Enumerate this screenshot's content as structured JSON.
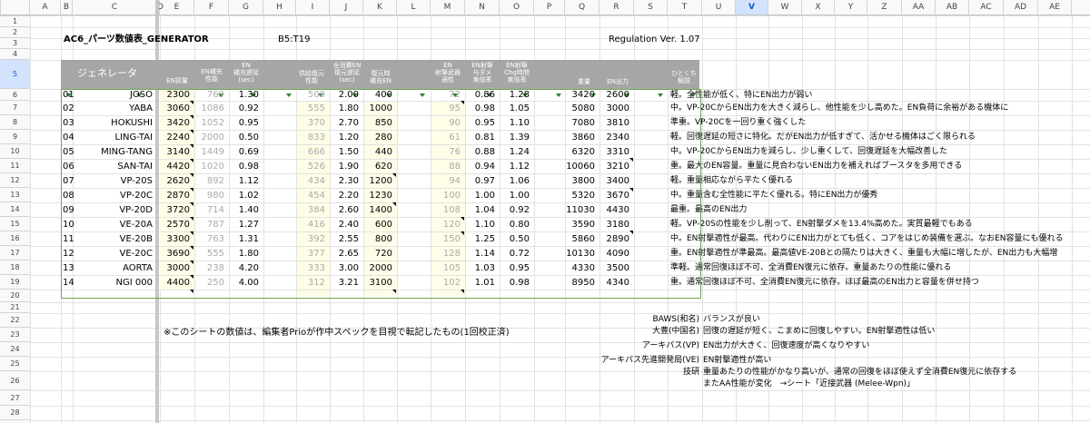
{
  "columns": [
    "A",
    "B",
    "C",
    "D",
    "E",
    "F",
    "G",
    "H",
    "I",
    "J",
    "K",
    "L",
    "M",
    "N",
    "O",
    "P",
    "Q",
    "R",
    "S",
    "T",
    "U",
    "V",
    "W",
    "X",
    "Y",
    "Z",
    "AA",
    "AB",
    "AC",
    "AD",
    "AE"
  ],
  "selected_column": "V",
  "row_numbers": [
    "1",
    "2",
    "3",
    "4",
    "5",
    "6",
    "7",
    "8",
    "9",
    "10",
    "11",
    "12",
    "13",
    "14",
    "15",
    "16",
    "17",
    "18",
    "19",
    "20",
    "21",
    "22",
    "23",
    "24",
    "25",
    "26",
    "27",
    "28"
  ],
  "title": "AC6_パーツ数値表_GENERATOR",
  "range_ref": "B5:T19",
  "regulation": "Regulation Ver. 1.07",
  "header": {
    "category": "ジェネレータ",
    "en_capacity": "EN容量",
    "en_recharge": "EN補充\n性能",
    "en_delay": "EN\n補充遅延\n(sec)",
    "supply_recovery": "供給復元\n性能",
    "depleted_delay": "全消費EN\n復元遅延\n(sec)",
    "recovery_en": "復元時\n補充EN",
    "en_weapon": "EN\n射撃武器\n適性",
    "dmg_rate": "EN射撃\n与ダメ\n実倍率",
    "chg_rate": "EN射撃\nChg時間\n実倍率",
    "weight": "重量",
    "en_output": "EN出力",
    "comment": "ひとくち\n解説"
  },
  "rows": [
    {
      "no": "01",
      "name": "JOSO",
      "cap": "2300",
      "rech": "769",
      "delay": "1.30",
      "sup": "500",
      "dd": "2.00",
      "ren": "400",
      "ew": "72",
      "dmg": "0.86",
      "chg": "1.28",
      "wt": "3420",
      "out": "2600",
      "note": "軽。全性能が低く、特にEN出力が弱い"
    },
    {
      "no": "02",
      "name": "YABA",
      "cap": "3060",
      "rech": "1086",
      "delay": "0.92",
      "sup": "555",
      "dd": "1.80",
      "ren": "1000",
      "ew": "95",
      "dmg": "0.98",
      "chg": "1.05",
      "wt": "5080",
      "out": "3000",
      "note": "中。VP-20CからEN出力を大きく減らし、他性能を少し高めた。EN負荷に余裕がある機体に"
    },
    {
      "no": "03",
      "name": "HOKUSHI",
      "cap": "3420",
      "rech": "1052",
      "delay": "0.95",
      "sup": "370",
      "dd": "2.70",
      "ren": "850",
      "ew": "90",
      "dmg": "0.95",
      "chg": "1.10",
      "wt": "7080",
      "out": "3810",
      "note": "準重。VP-20Cを一回り重く強くした"
    },
    {
      "no": "04",
      "name": "LING-TAI",
      "cap": "2240",
      "rech": "2000",
      "delay": "0.50",
      "sup": "833",
      "dd": "1.20",
      "ren": "280",
      "ew": "61",
      "dmg": "0.81",
      "chg": "1.39",
      "wt": "3860",
      "out": "2340",
      "note": "軽。回復遅延の短さに特化。だがEN出力が低すぎて、活かせる機体はごく限られる"
    },
    {
      "no": "05",
      "name": "MING-TANG",
      "cap": "3140",
      "rech": "1449",
      "delay": "0.69",
      "sup": "666",
      "dd": "1.50",
      "ren": "440",
      "ew": "76",
      "dmg": "0.88",
      "chg": "1.24",
      "wt": "6320",
      "out": "3310",
      "note": "中。VP-20CからEN出力を減らし、少し重くして、回復遅延を大幅改善した"
    },
    {
      "no": "06",
      "name": "SAN-TAI",
      "cap": "4420",
      "rech": "1020",
      "delay": "0.98",
      "sup": "526",
      "dd": "1.90",
      "ren": "620",
      "ew": "88",
      "dmg": "0.94",
      "chg": "1.12",
      "wt": "10060",
      "out": "3210",
      "note": "重。最大のEN容量。重量に見合わないEN出力を補えればブースタを多用できる"
    },
    {
      "no": "07",
      "name": "VP-20S",
      "cap": "2620",
      "rech": "892",
      "delay": "1.12",
      "sup": "434",
      "dd": "2.30",
      "ren": "1200",
      "ew": "94",
      "dmg": "0.97",
      "chg": "1.06",
      "wt": "3800",
      "out": "3400",
      "note": "軽。重量相応ながら平たく優れる"
    },
    {
      "no": "08",
      "name": "VP-20C",
      "cap": "2870",
      "rech": "980",
      "delay": "1.02",
      "sup": "454",
      "dd": "2.20",
      "ren": "1230",
      "ew": "100",
      "dmg": "1.00",
      "chg": "1.00",
      "wt": "5320",
      "out": "3670",
      "note": "中。重量含む全性能に平たく優れる。特にEN出力が優秀"
    },
    {
      "no": "09",
      "name": "VP-20D",
      "cap": "3720",
      "rech": "714",
      "delay": "1.40",
      "sup": "384",
      "dd": "2.60",
      "ren": "1400",
      "ew": "108",
      "dmg": "1.04",
      "chg": "0.92",
      "wt": "11030",
      "out": "4430",
      "note": "最重。最高のEN出力"
    },
    {
      "no": "10",
      "name": "VE-20A",
      "cap": "2570",
      "rech": "787",
      "delay": "1.27",
      "sup": "416",
      "dd": "2.40",
      "ren": "600",
      "ew": "120",
      "dmg": "1.10",
      "chg": "0.80",
      "wt": "3590",
      "out": "3180",
      "note": "軽。VP-20Sの性能を少し削って、EN射撃ダメを13.4%高めた。実質最軽でもある"
    },
    {
      "no": "11",
      "name": "VE-20B",
      "cap": "3300",
      "rech": "763",
      "delay": "1.31",
      "sup": "392",
      "dd": "2.55",
      "ren": "800",
      "ew": "150",
      "dmg": "1.25",
      "chg": "0.50",
      "wt": "5860",
      "out": "2890",
      "note": "中。EN射撃適性が最高。代わりにEN出力がとても低く、コアをはじめ装備を選ぶ。なおEN容量にも優れる"
    },
    {
      "no": "12",
      "name": "VE-20C",
      "cap": "3690",
      "rech": "555",
      "delay": "1.80",
      "sup": "377",
      "dd": "2.65",
      "ren": "720",
      "ew": "128",
      "dmg": "1.14",
      "chg": "0.72",
      "wt": "10130",
      "out": "4090",
      "note": "重。EN射撃適性が準最高。最高値VE-20Bとの隔たりは大きく、重量も大幅に増したが、EN出力も大幅増"
    },
    {
      "no": "13",
      "name": "AORTA",
      "cap": "3000",
      "rech": "238",
      "delay": "4.20",
      "sup": "333",
      "dd": "3.00",
      "ren": "2000",
      "ew": "105",
      "dmg": "1.03",
      "chg": "0.95",
      "wt": "4330",
      "out": "3500",
      "note": "準軽。通常回復ほぼ不可、全消費EN復元に依存。重量あたりの性能に優れる"
    },
    {
      "no": "14",
      "name": "NGI 000",
      "cap": "4400",
      "rech": "250",
      "delay": "4.00",
      "sup": "312",
      "dd": "3.21",
      "ren": "3100",
      "ew": "102",
      "dmg": "1.01",
      "chg": "0.98",
      "wt": "8950",
      "out": "4340",
      "note": "重。通常回復ほぼ不可、全消費EN復元に依存。ほぼ最高のEN出力と容量を併せ持つ"
    }
  ],
  "footnote": "※このシートの数値は、編集者Prioが作中スペックを目視で転記したもの(1回校正済)",
  "legend": [
    {
      "label": "BAWS(和名)",
      "text": "バランスが良い"
    },
    {
      "label": "大豊(中国名)",
      "text": "回復の遅延が短く、こまめに回復しやすい。EN射撃適性は低い"
    },
    {
      "label": "アーキバス(VP)",
      "text": "EN出力が大きく、回復速度が高くなりやすい"
    },
    {
      "label": "アーキバス先進開発局(VE)",
      "text": "EN射撃適性が高い"
    },
    {
      "label": "技研",
      "text": "重量あたりの性能がかなり高いが、通常の回復をほぼ使えず全消費EN復元に依存する"
    }
  ],
  "legend_extra": "またAA性能が変化　→シート「近接武器 (Melee-Wpn)」"
}
